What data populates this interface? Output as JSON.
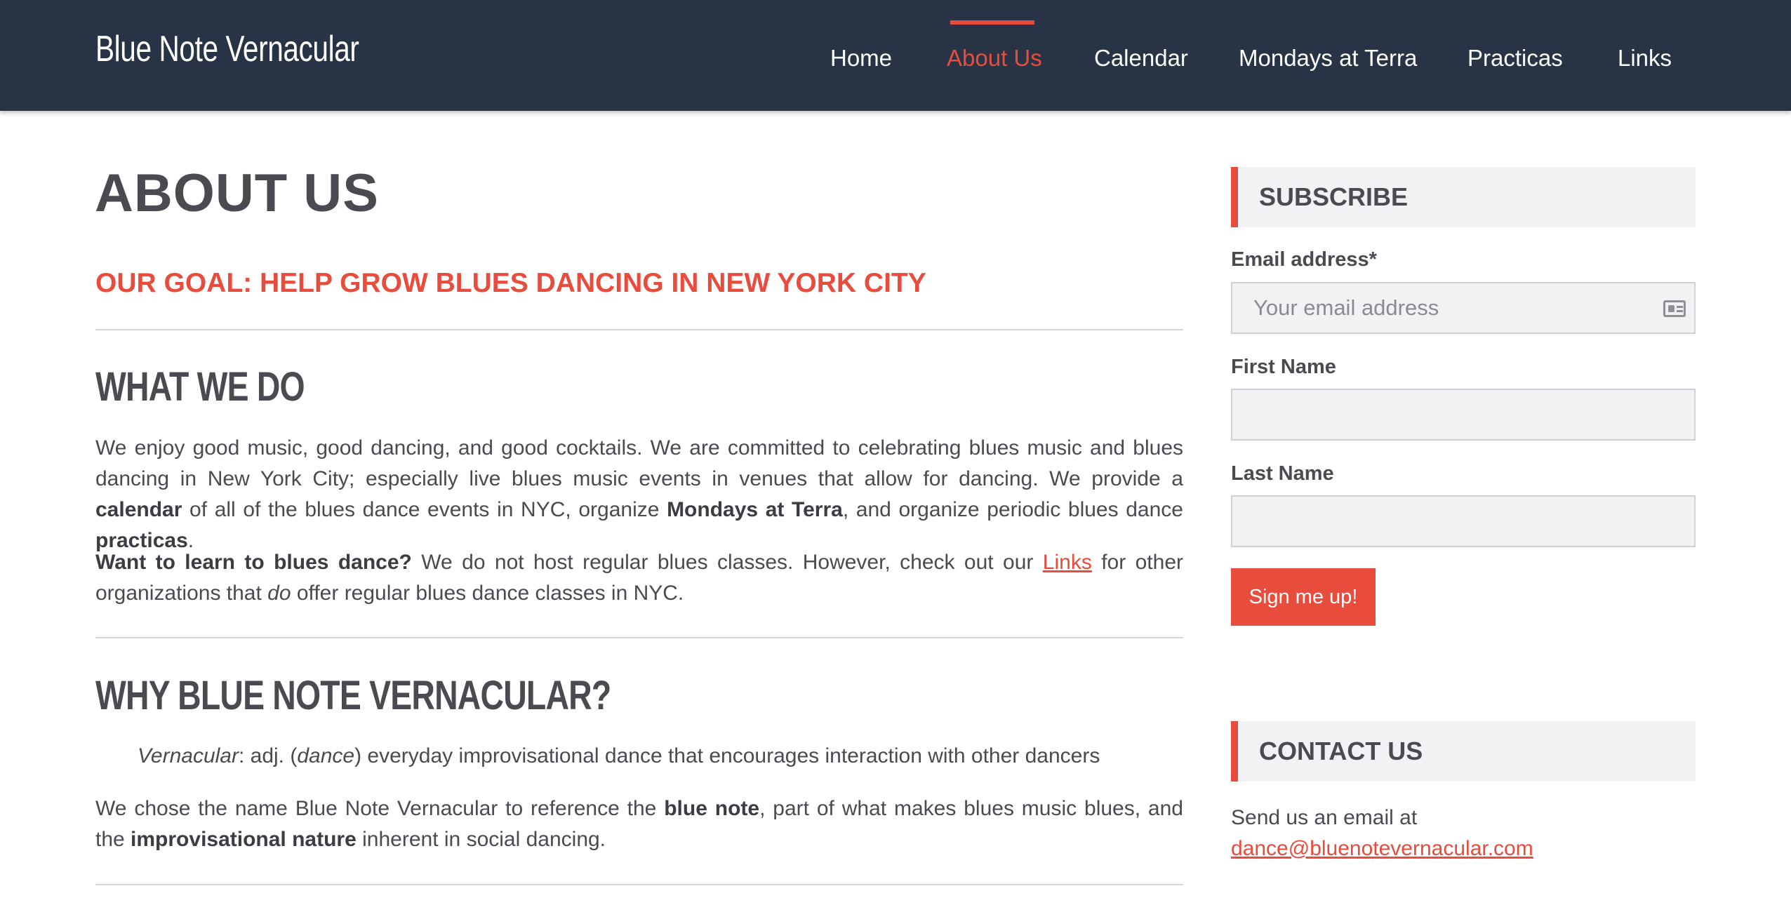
{
  "header": {
    "site_title": "Blue Note Vernacular",
    "nav": [
      {
        "label": "Home",
        "active": false
      },
      {
        "label": "About Us",
        "active": true
      },
      {
        "label": "Calendar",
        "active": false
      },
      {
        "label": "Mondays at Terra",
        "active": false
      },
      {
        "label": "Practicas",
        "active": false
      },
      {
        "label": "Links",
        "active": false
      }
    ]
  },
  "main": {
    "page_title": "ABOUT US",
    "goal": "OUR GOAL: HELP GROW BLUES DANCING IN NEW YORK CITY",
    "what_we_do": {
      "heading": "WHAT WE DO",
      "p1": {
        "text1": "We enjoy good music, good dancing, and good cocktails.  We are committed to celebrating blues music and blues dancing in New York City; especially live blues music events in venues that allow for dancing.  We provide a ",
        "bold1": "calendar",
        "text2": " of all of the blues dance events in NYC, organize ",
        "bold2": "Mondays at Terra",
        "text3": ", and organize periodic blues dance ",
        "bold3": "practicas",
        "text4": "."
      },
      "p2": {
        "bold1": "Want to learn to blues dance?",
        "text1": "  We do not host regular blues classes.  However, check out our ",
        "link": "Links",
        "text2": " for other organizations that ",
        "italic": "do",
        "text3": " offer regular blues dance classes in NYC."
      }
    },
    "why": {
      "heading": "WHY BLUE NOTE VERNACULAR?",
      "definition": {
        "term": "Vernacular",
        "text1": ": adj. (",
        "pos": "dance",
        "text2": ") everyday improvisational dance that encourages interaction with other dancers"
      },
      "p1": {
        "text1": "We chose the name Blue Note Vernacular to reference the ",
        "bold1": "blue note",
        "text2": ", part of what makes blues music blues, and the ",
        "bold2": "improvisational nature",
        "text3": " inherent in social dancing."
      }
    }
  },
  "sidebar": {
    "subscribe": {
      "heading": "SUBSCRIBE",
      "email_label": "Email address*",
      "email_placeholder": "Your email address",
      "first_name_label": "First Name",
      "last_name_label": "Last Name",
      "button": "Sign me up!"
    },
    "contact": {
      "heading": "CONTACT US",
      "text": "Send us an email at",
      "email": "dance@bluenotevernacular.com"
    }
  },
  "colors": {
    "header_bg": "#283445",
    "accent": "#e84c3d",
    "text": "#4a4a50"
  }
}
